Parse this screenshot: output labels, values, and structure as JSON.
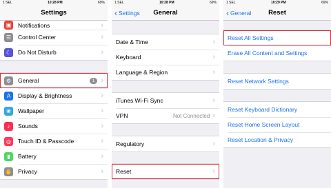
{
  "screens": [
    {
      "status": {
        "carrier": "1 SEL",
        "time": "10:28 PM",
        "battery": "69%"
      },
      "title": "Settings",
      "top_partial": "Notifications",
      "group1": [
        "Control Center",
        "Do Not Disturb"
      ],
      "group2": [
        {
          "label": "General",
          "badge": "1"
        },
        {
          "label": "Display & Brightness"
        },
        {
          "label": "Wallpaper"
        },
        {
          "label": "Sounds"
        },
        {
          "label": "Touch ID & Passcode"
        },
        {
          "label": "Battery"
        },
        {
          "label": "Privacy"
        }
      ]
    },
    {
      "status": {
        "carrier": "1 SEL",
        "time": "10:28 PM",
        "battery": "69%"
      },
      "back": "Settings",
      "title": "General",
      "group1": [
        "Date & Time",
        "Keyboard",
        "Language & Region"
      ],
      "group2": [
        {
          "label": "iTunes Wi-Fi Sync"
        },
        {
          "label": "VPN",
          "value": "Not Connected"
        }
      ],
      "group3": [
        "Regulatory"
      ],
      "group4": [
        "Reset"
      ]
    },
    {
      "status": {
        "carrier": "1 SEL",
        "time": "10:29 PM",
        "battery": "69%"
      },
      "back": "General",
      "title": "Reset",
      "group1": [
        "Reset All Settings",
        "Erase All Content and Settings"
      ],
      "group2": [
        "Reset Network Settings"
      ],
      "group3": [
        "Reset Keyboard Dictionary",
        "Reset Home Screen Layout",
        "Reset Location & Privacy"
      ]
    }
  ],
  "icons": {
    "notifications": "notifications-icon",
    "control_center": "control-center-icon",
    "dnd": "moon-icon",
    "general": "gear-icon",
    "display": "display-icon",
    "wallpaper": "wallpaper-icon",
    "sounds": "speaker-icon",
    "touchid": "fingerprint-icon",
    "battery": "battery-icon",
    "privacy": "hand-icon"
  },
  "colors": {
    "accent": "#1a73e8",
    "highlight": "#d9303a"
  }
}
